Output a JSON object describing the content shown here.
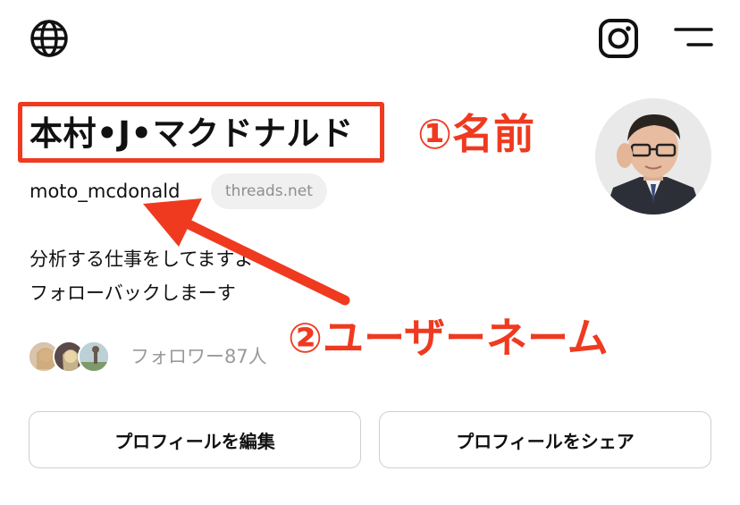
{
  "header": {
    "globe_icon": "globe-icon",
    "instagram_icon": "instagram-icon",
    "menu_icon": "menu-icon"
  },
  "profile": {
    "name": "本村•J•マクドナルド",
    "username": "moto_mcdonald",
    "domain_badge": "threads.net",
    "bio_lines": [
      "分析する仕事をしてますよ",
      "フォローバックしまーす"
    ],
    "followers_text": "フォロワー87人"
  },
  "annotations": {
    "name_label": "①名前",
    "username_label": "②ユーザーネーム",
    "color": "#ef3a20"
  },
  "buttons": {
    "edit_profile": "プロフィールを編集",
    "share_profile": "プロフィールをシェア"
  }
}
